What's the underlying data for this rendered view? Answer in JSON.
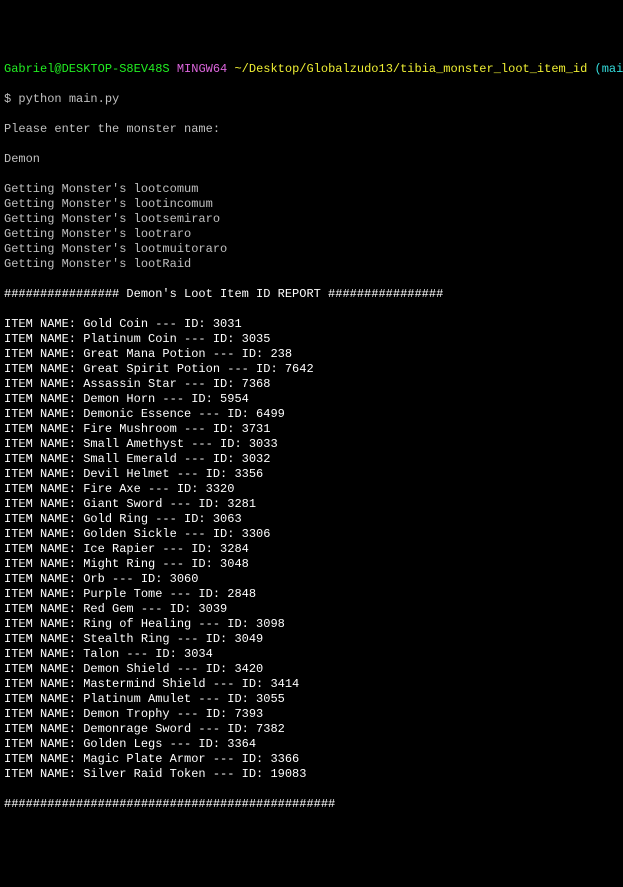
{
  "prompt": {
    "userhost": "Gabriel@DESKTOP-S8EV48S",
    "shell": "MINGW64",
    "path": "~/Desktop/Globalzudo13/tibia_monster_loot_item_id",
    "branch": "(main)"
  },
  "command_prefix": "$ ",
  "command": "python main.py",
  "prompt_text": "Please enter the monster name:",
  "monster_input": "Demon",
  "getting_lines": [
    "Getting Monster's lootcomum",
    "Getting Monster's lootincomum",
    "Getting Monster's lootsemiraro",
    "Getting Monster's lootraro",
    "Getting Monster's lootmuitoraro",
    "Getting Monster's lootRaid"
  ],
  "report_header": "################ Demon's Loot Item ID REPORT ################",
  "loot_items": [
    {
      "name": "Gold Coin",
      "id": "3031"
    },
    {
      "name": "Platinum Coin",
      "id": "3035"
    },
    {
      "name": "Great Mana Potion",
      "id": "238"
    },
    {
      "name": "Great Spirit Potion",
      "id": "7642"
    },
    {
      "name": "Assassin Star",
      "id": "7368"
    },
    {
      "name": "Demon Horn",
      "id": "5954"
    },
    {
      "name": "Demonic Essence",
      "id": "6499"
    },
    {
      "name": "Fire Mushroom",
      "id": "3731"
    },
    {
      "name": "Small Amethyst",
      "id": "3033"
    },
    {
      "name": "Small Emerald",
      "id": "3032"
    },
    {
      "name": "Devil Helmet",
      "id": "3356"
    },
    {
      "name": "Fire Axe",
      "id": "3320"
    },
    {
      "name": "Giant Sword",
      "id": "3281"
    },
    {
      "name": "Gold Ring",
      "id": "3063"
    },
    {
      "name": "Golden Sickle",
      "id": "3306"
    },
    {
      "name": "Ice Rapier",
      "id": "3284"
    },
    {
      "name": "Might Ring",
      "id": "3048"
    },
    {
      "name": "Orb",
      "id": "3060"
    },
    {
      "name": "Purple Tome",
      "id": "2848"
    },
    {
      "name": "Red Gem",
      "id": "3039"
    },
    {
      "name": "Ring of Healing",
      "id": "3098"
    },
    {
      "name": "Stealth Ring",
      "id": "3049"
    },
    {
      "name": "Talon",
      "id": "3034"
    },
    {
      "name": "Demon Shield",
      "id": "3420"
    },
    {
      "name": "Mastermind Shield",
      "id": "3414"
    },
    {
      "name": "Platinum Amulet",
      "id": "3055"
    },
    {
      "name": "Demon Trophy",
      "id": "7393"
    },
    {
      "name": "Demonrage Sword",
      "id": "7382"
    },
    {
      "name": "Golden Legs",
      "id": "3364"
    },
    {
      "name": "Magic Plate Armor",
      "id": "3366"
    },
    {
      "name": "Silver Raid Token",
      "id": "19083"
    }
  ],
  "item_line_prefix": "ITEM NAME: ",
  "item_line_mid": " --- ID: ",
  "report_footer": "##############################################"
}
